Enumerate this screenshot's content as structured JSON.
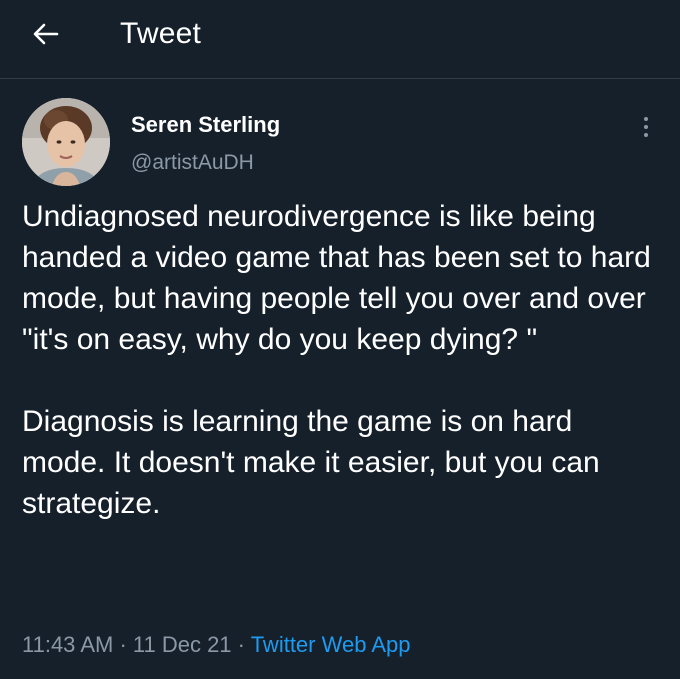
{
  "header": {
    "back_icon": "arrow-left-icon",
    "title": "Tweet"
  },
  "author": {
    "avatar_icon": "profile-photo",
    "name": "Seren Sterling",
    "handle": "@artistAuDH"
  },
  "more_icon": "vertical-ellipsis-icon",
  "tweet": {
    "paragraph_1": "Undiagnosed neurodivergence is like being handed a video game that has been set to hard mode, but having people tell you over and over \"it's on easy, why do you keep dying? \"",
    "paragraph_2": "Diagnosis is learning the game is on hard mode. It doesn't make it easier, but you can strategize."
  },
  "meta": {
    "time": "11:43 AM",
    "separator_1": " · ",
    "date": "11 Dec 21",
    "separator_2": " · ",
    "source": "Twitter Web App"
  },
  "colors": {
    "background": "#15202b",
    "text": "#ffffff",
    "secondary": "#8b98a5",
    "link": "#1d9bf0"
  }
}
